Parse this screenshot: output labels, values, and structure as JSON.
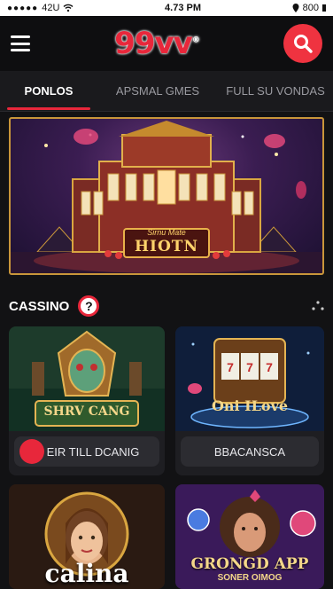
{
  "status": {
    "carrier": "42U",
    "time": "4.73 PM",
    "battery": "800"
  },
  "header": {
    "logo": "99vv",
    "logo_mark": "®"
  },
  "tabs": [
    {
      "label": "PONLOS",
      "active": true
    },
    {
      "label": "APSMAL GMES",
      "active": false
    },
    {
      "label": "FULL SU VONDAS",
      "active": false
    }
  ],
  "banner": {
    "sign_text": "HIOTN",
    "sign_subtext": "Sirnu Mate"
  },
  "section": {
    "title": "CASSINO",
    "help": "?"
  },
  "cards": [
    {
      "art_title": "SHRV CANG",
      "button_label": "EIR TILL DCANIG"
    },
    {
      "art_title": "Oni ILove",
      "button_label": "BBACANSCA"
    },
    {
      "art_title": "calina",
      "button_label": ""
    },
    {
      "art_title": "GRONGD APP",
      "art_subtitle": "SONER OIMOG",
      "button_label": ""
    }
  ],
  "colors": {
    "accent": "#e8273b",
    "gold": "#c9963a",
    "background": "#121214"
  }
}
